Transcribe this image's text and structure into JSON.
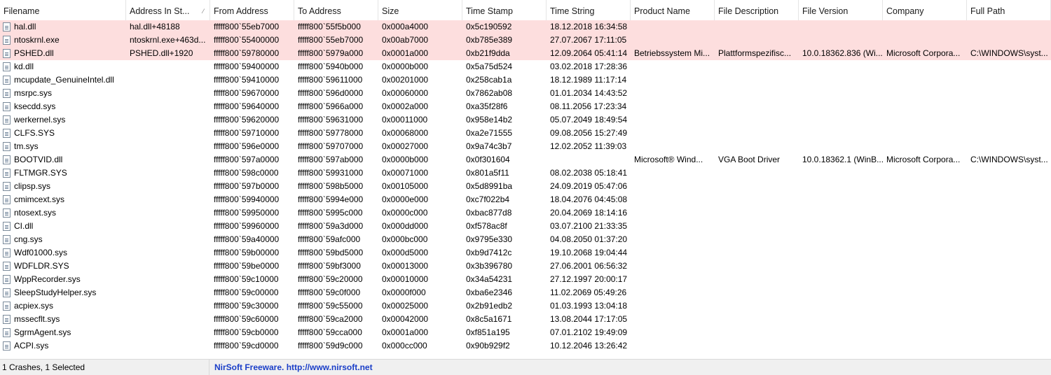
{
  "columns": [
    {
      "label": "Filename"
    },
    {
      "label": "Address In St..."
    },
    {
      "label": "From Address"
    },
    {
      "label": "To Address"
    },
    {
      "label": "Size"
    },
    {
      "label": "Time Stamp"
    },
    {
      "label": "Time String"
    },
    {
      "label": "Product Name"
    },
    {
      "label": "File Description"
    },
    {
      "label": "File Version"
    },
    {
      "label": "Company"
    },
    {
      "label": "Full Path"
    }
  ],
  "rows": [
    {
      "crash": true,
      "cells": [
        "hal.dll",
        "hal.dll+48188",
        "fffff800`55eb7000",
        "fffff800`55f5b000",
        "0x000a4000",
        "0x5c190592",
        "18.12.2018 16:34:58",
        "",
        "",
        "",
        "",
        ""
      ]
    },
    {
      "crash": true,
      "cells": [
        "ntoskrnl.exe",
        "ntoskrnl.exe+463d...",
        "fffff800`55400000",
        "fffff800`55eb7000",
        "0x00ab7000",
        "0xb785e389",
        "27.07.2067 17:11:05",
        "",
        "",
        "",
        "",
        ""
      ]
    },
    {
      "crash": true,
      "cells": [
        "PSHED.dll",
        "PSHED.dll+1920",
        "fffff800`59780000",
        "fffff800`5979a000",
        "0x0001a000",
        "0xb21f9dda",
        "12.09.2064 05:41:14",
        "Betriebssystem Mi...",
        "Plattformspezifisc...",
        "10.0.18362.836 (Wi...",
        "Microsoft Corpora...",
        "C:\\WINDOWS\\syst..."
      ]
    },
    {
      "crash": false,
      "cells": [
        "kd.dll",
        "",
        "fffff800`59400000",
        "fffff800`5940b000",
        "0x0000b000",
        "0x5a75d524",
        "03.02.2018 17:28:36",
        "",
        "",
        "",
        "",
        ""
      ]
    },
    {
      "crash": false,
      "cells": [
        "mcupdate_GenuineIntel.dll",
        "",
        "fffff800`59410000",
        "fffff800`59611000",
        "0x00201000",
        "0x258cab1a",
        "18.12.1989 11:17:14",
        "",
        "",
        "",
        "",
        ""
      ]
    },
    {
      "crash": false,
      "cells": [
        "msrpc.sys",
        "",
        "fffff800`59670000",
        "fffff800`596d0000",
        "0x00060000",
        "0x7862ab08",
        "01.01.2034 14:43:52",
        "",
        "",
        "",
        "",
        ""
      ]
    },
    {
      "crash": false,
      "cells": [
        "ksecdd.sys",
        "",
        "fffff800`59640000",
        "fffff800`5966a000",
        "0x0002a000",
        "0xa35f28f6",
        "08.11.2056 17:23:34",
        "",
        "",
        "",
        "",
        ""
      ]
    },
    {
      "crash": false,
      "cells": [
        "werkernel.sys",
        "",
        "fffff800`59620000",
        "fffff800`59631000",
        "0x00011000",
        "0x958e14b2",
        "05.07.2049 18:49:54",
        "",
        "",
        "",
        "",
        ""
      ]
    },
    {
      "crash": false,
      "cells": [
        "CLFS.SYS",
        "",
        "fffff800`59710000",
        "fffff800`59778000",
        "0x00068000",
        "0xa2e71555",
        "09.08.2056 15:27:49",
        "",
        "",
        "",
        "",
        ""
      ]
    },
    {
      "crash": false,
      "cells": [
        "tm.sys",
        "",
        "fffff800`596e0000",
        "fffff800`59707000",
        "0x00027000",
        "0x9a74c3b7",
        "12.02.2052 11:39:03",
        "",
        "",
        "",
        "",
        ""
      ]
    },
    {
      "crash": false,
      "cells": [
        "BOOTVID.dll",
        "",
        "fffff800`597a0000",
        "fffff800`597ab000",
        "0x0000b000",
        "0x0f301604",
        "",
        "Microsoft® Wind...",
        "VGA Boot Driver",
        "10.0.18362.1 (WinB...",
        "Microsoft Corpora...",
        "C:\\WINDOWS\\syst..."
      ]
    },
    {
      "crash": false,
      "cells": [
        "FLTMGR.SYS",
        "",
        "fffff800`598c0000",
        "fffff800`59931000",
        "0x00071000",
        "0x801a5f11",
        "08.02.2038 05:18:41",
        "",
        "",
        "",
        "",
        ""
      ]
    },
    {
      "crash": false,
      "cells": [
        "clipsp.sys",
        "",
        "fffff800`597b0000",
        "fffff800`598b5000",
        "0x00105000",
        "0x5d8991ba",
        "24.09.2019 05:47:06",
        "",
        "",
        "",
        "",
        ""
      ]
    },
    {
      "crash": false,
      "cells": [
        "cmimcext.sys",
        "",
        "fffff800`59940000",
        "fffff800`5994e000",
        "0x0000e000",
        "0xc7f022b4",
        "18.04.2076 04:45:08",
        "",
        "",
        "",
        "",
        ""
      ]
    },
    {
      "crash": false,
      "cells": [
        "ntosext.sys",
        "",
        "fffff800`59950000",
        "fffff800`5995c000",
        "0x0000c000",
        "0xbac877d8",
        "20.04.2069 18:14:16",
        "",
        "",
        "",
        "",
        ""
      ]
    },
    {
      "crash": false,
      "cells": [
        "CI.dll",
        "",
        "fffff800`59960000",
        "fffff800`59a3d000",
        "0x000dd000",
        "0xf578ac8f",
        "03.07.2100 21:33:35",
        "",
        "",
        "",
        "",
        ""
      ]
    },
    {
      "crash": false,
      "cells": [
        "cng.sys",
        "",
        "fffff800`59a40000",
        "fffff800`59afc000",
        "0x000bc000",
        "0x9795e330",
        "04.08.2050 01:37:20",
        "",
        "",
        "",
        "",
        ""
      ]
    },
    {
      "crash": false,
      "cells": [
        "Wdf01000.sys",
        "",
        "fffff800`59b00000",
        "fffff800`59bd5000",
        "0x000d5000",
        "0xb9d7412c",
        "19.10.2068 19:04:44",
        "",
        "",
        "",
        "",
        ""
      ]
    },
    {
      "crash": false,
      "cells": [
        "WDFLDR.SYS",
        "",
        "fffff800`59be0000",
        "fffff800`59bf3000",
        "0x00013000",
        "0x3b396780",
        "27.06.2001 06:56:32",
        "",
        "",
        "",
        "",
        ""
      ]
    },
    {
      "crash": false,
      "cells": [
        "WppRecorder.sys",
        "",
        "fffff800`59c10000",
        "fffff800`59c20000",
        "0x00010000",
        "0x34a54231",
        "27.12.1997 20:00:17",
        "",
        "",
        "",
        "",
        ""
      ]
    },
    {
      "crash": false,
      "cells": [
        "SleepStudyHelper.sys",
        "",
        "fffff800`59c00000",
        "fffff800`59c0f000",
        "0x0000f000",
        "0xba6e2346",
        "11.02.2069 05:49:26",
        "",
        "",
        "",
        "",
        ""
      ]
    },
    {
      "crash": false,
      "cells": [
        "acpiex.sys",
        "",
        "fffff800`59c30000",
        "fffff800`59c55000",
        "0x00025000",
        "0x2b91edb2",
        "01.03.1993 13:04:18",
        "",
        "",
        "",
        "",
        ""
      ]
    },
    {
      "crash": false,
      "cells": [
        "mssecflt.sys",
        "",
        "fffff800`59c60000",
        "fffff800`59ca2000",
        "0x00042000",
        "0x8c5a1671",
        "13.08.2044 17:17:05",
        "",
        "",
        "",
        "",
        ""
      ]
    },
    {
      "crash": false,
      "cells": [
        "SgrmAgent.sys",
        "",
        "fffff800`59cb0000",
        "fffff800`59cca000",
        "0x0001a000",
        "0xf851a195",
        "07.01.2102 19:49:09",
        "",
        "",
        "",
        "",
        ""
      ]
    },
    {
      "crash": false,
      "cells": [
        "ACPI.sys",
        "",
        "fffff800`59cd0000",
        "fffff800`59d9c000",
        "0x000cc000",
        "0x90b929f2",
        "10.12.2046 13:26:42",
        "",
        "",
        "",
        "",
        ""
      ]
    }
  ],
  "status": {
    "selection": "1 Crashes, 1 Selected",
    "freeware": "NirSoft Freeware.  http://www.nirsoft.net"
  }
}
